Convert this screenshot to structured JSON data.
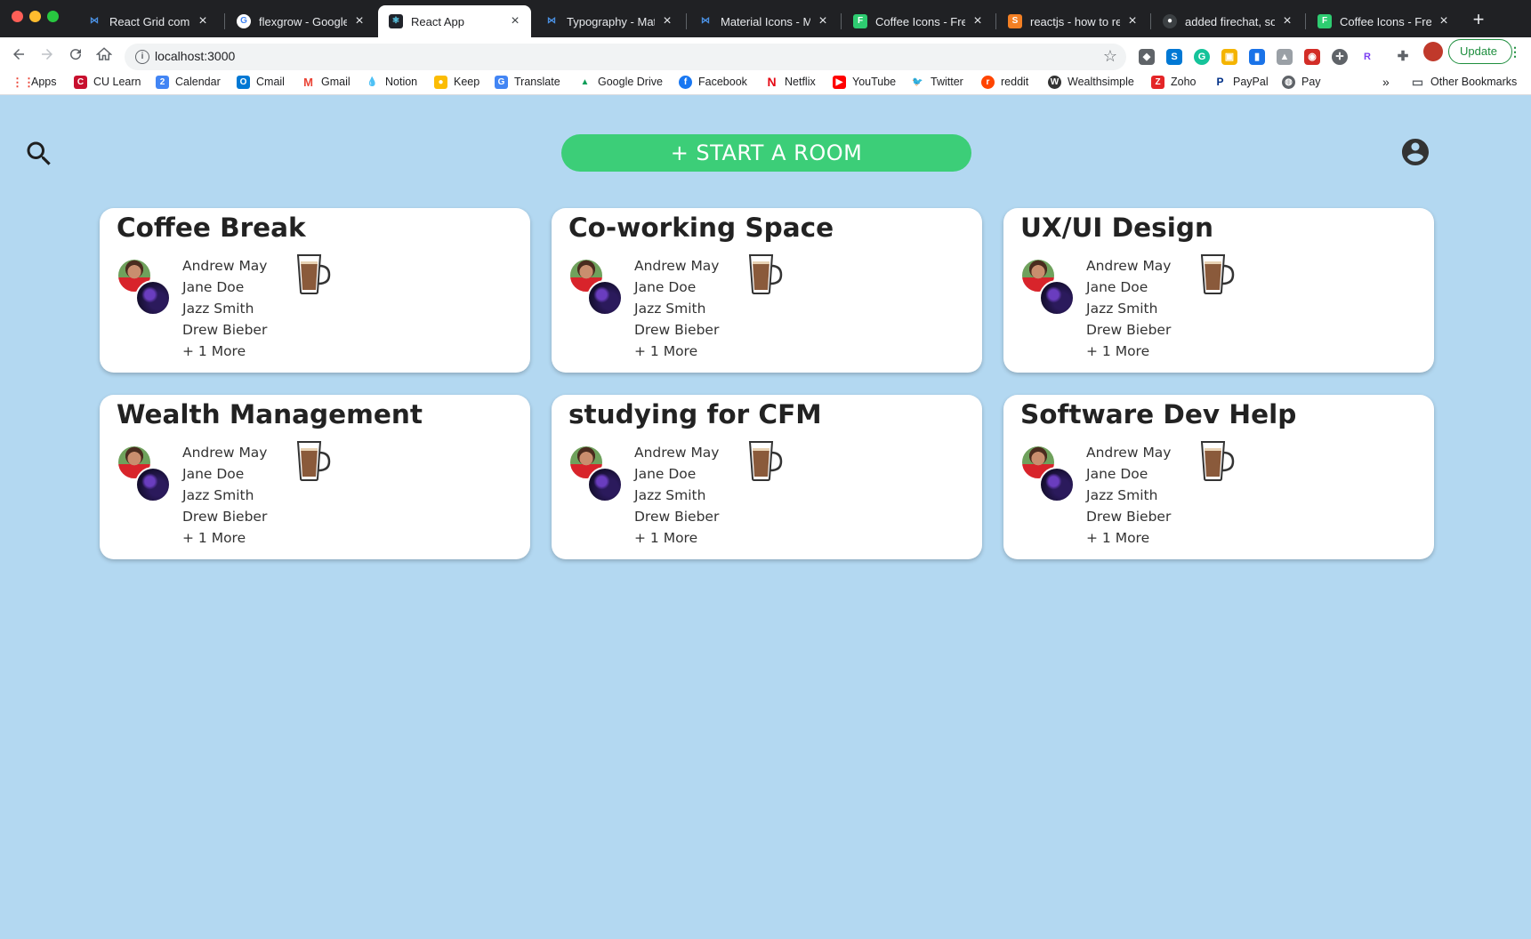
{
  "browser": {
    "tabs": [
      {
        "label": "React Grid compon",
        "icon": "mui-icon",
        "color": "#4a90e2"
      },
      {
        "label": "flexgrow - Google S",
        "icon": "google-icon",
        "color": "#ffffff"
      },
      {
        "label": "React App",
        "icon": "react-icon",
        "color": "#61dafb"
      },
      {
        "label": "Typography - Mate",
        "icon": "mui-icon",
        "color": "#4a90e2"
      },
      {
        "label": "Material Icons - Ma",
        "icon": "mui-icon",
        "color": "#4a90e2"
      },
      {
        "label": "Coffee Icons - Free",
        "icon": "flaticon-icon",
        "color": "#2ecc71"
      },
      {
        "label": "reactjs - how to res",
        "icon": "stackoverflow-icon",
        "color": "#f48024"
      },
      {
        "label": "added firechat, son",
        "icon": "github-icon",
        "color": "#ffffff"
      },
      {
        "label": "Coffee Icons - Free",
        "icon": "flaticon-icon",
        "color": "#2ecc71"
      }
    ],
    "new_tab": "+",
    "url": "localhost:3000",
    "update_label": "Update",
    "bookmarks": [
      {
        "label": "Apps"
      },
      {
        "label": "CU Learn"
      },
      {
        "label": "Calendar"
      },
      {
        "label": "Cmail"
      },
      {
        "label": "Gmail"
      },
      {
        "label": "Notion"
      },
      {
        "label": "Keep"
      },
      {
        "label": "Translate"
      },
      {
        "label": "Google Drive"
      },
      {
        "label": "Facebook"
      },
      {
        "label": "Netflix"
      },
      {
        "label": "YouTube"
      },
      {
        "label": "Twitter"
      },
      {
        "label": "reddit"
      },
      {
        "label": "Wealthsimple"
      },
      {
        "label": "Zoho"
      },
      {
        "label": "PayPal"
      },
      {
        "label": "Pay"
      }
    ],
    "bookmarks_overflow": "»",
    "other_bookmarks": "Other Bookmarks"
  },
  "app": {
    "start_room_label": "+ START A ROOM",
    "accent_color": "#3cce78",
    "background_color": "#b3d8f1",
    "rooms": [
      {
        "title": "Coffee Break",
        "members": [
          "Andrew May",
          "Jane Doe",
          "Jazz Smith",
          "Drew Bieber"
        ],
        "more": "+ 1 More"
      },
      {
        "title": "Co-working Space",
        "members": [
          "Andrew May",
          "Jane Doe",
          "Jazz Smith",
          "Drew Bieber"
        ],
        "more": "+ 1 More"
      },
      {
        "title": "UX/UI Design",
        "members": [
          "Andrew May",
          "Jane Doe",
          "Jazz Smith",
          "Drew Bieber"
        ],
        "more": "+ 1 More"
      },
      {
        "title": "Wealth Management",
        "members": [
          "Andrew May",
          "Jane Doe",
          "Jazz Smith",
          "Drew Bieber"
        ],
        "more": "+ 1 More"
      },
      {
        "title": "studying for CFM",
        "members": [
          "Andrew May",
          "Jane Doe",
          "Jazz Smith",
          "Drew Bieber"
        ],
        "more": "+ 1 More"
      },
      {
        "title": "Software Dev Help",
        "members": [
          "Andrew May",
          "Jane Doe",
          "Jazz Smith",
          "Drew Bieber"
        ],
        "more": "+ 1 More"
      }
    ]
  }
}
